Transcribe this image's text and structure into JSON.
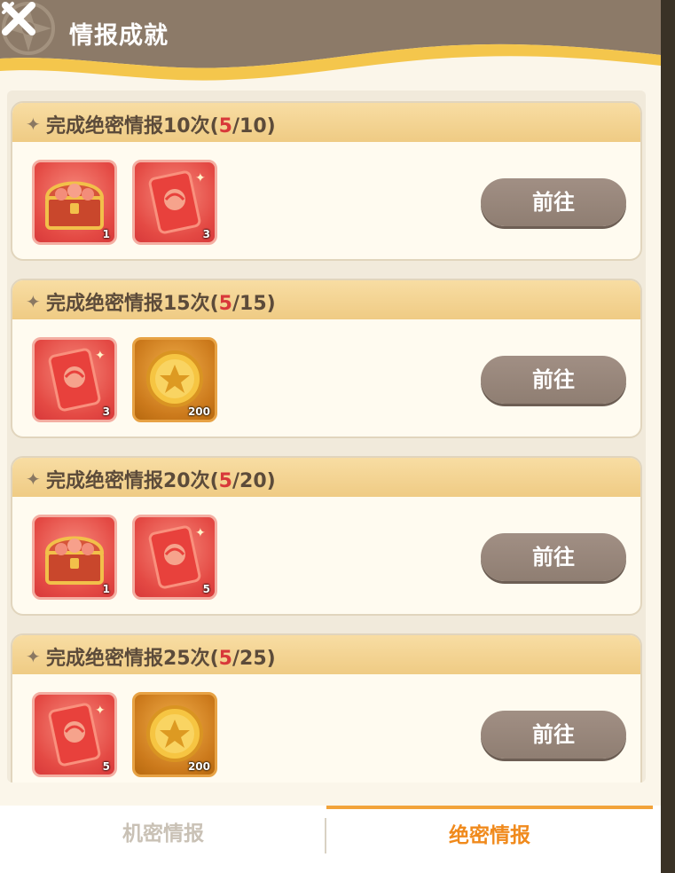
{
  "header": {
    "title": "情报成就"
  },
  "tasks": [
    {
      "prefix": "完成绝密情报10次(",
      "current": "5",
      "rest": "/10)",
      "button": "前往",
      "rewards": [
        {
          "icon": "treasure-chest-icon",
          "count": "1"
        },
        {
          "icon": "red-envelope-icon",
          "count": "3"
        }
      ]
    },
    {
      "prefix": "完成绝密情报15次(",
      "current": "5",
      "rest": "/15)",
      "button": "前往",
      "rewards": [
        {
          "icon": "red-envelope-icon",
          "count": "3"
        },
        {
          "icon": "gold-coin-icon",
          "count": "200"
        }
      ]
    },
    {
      "prefix": "完成绝密情报20次(",
      "current": "5",
      "rest": "/20)",
      "button": "前往",
      "rewards": [
        {
          "icon": "treasure-chest-icon",
          "count": "1"
        },
        {
          "icon": "red-envelope-icon",
          "count": "5"
        }
      ]
    },
    {
      "prefix": "完成绝密情报25次(",
      "current": "5",
      "rest": "/25)",
      "button": "前往",
      "rewards": [
        {
          "icon": "red-envelope-icon",
          "count": "5"
        },
        {
          "icon": "gold-coin-icon",
          "count": "200"
        }
      ]
    }
  ],
  "tabs": [
    {
      "label": "机密情报",
      "active": false
    },
    {
      "label": "绝密情报",
      "active": true
    }
  ],
  "colors": {
    "header": "#8c7a68",
    "accent": "#f08a1c",
    "progress": "#d8383a",
    "card_head": "#f3d28e"
  }
}
